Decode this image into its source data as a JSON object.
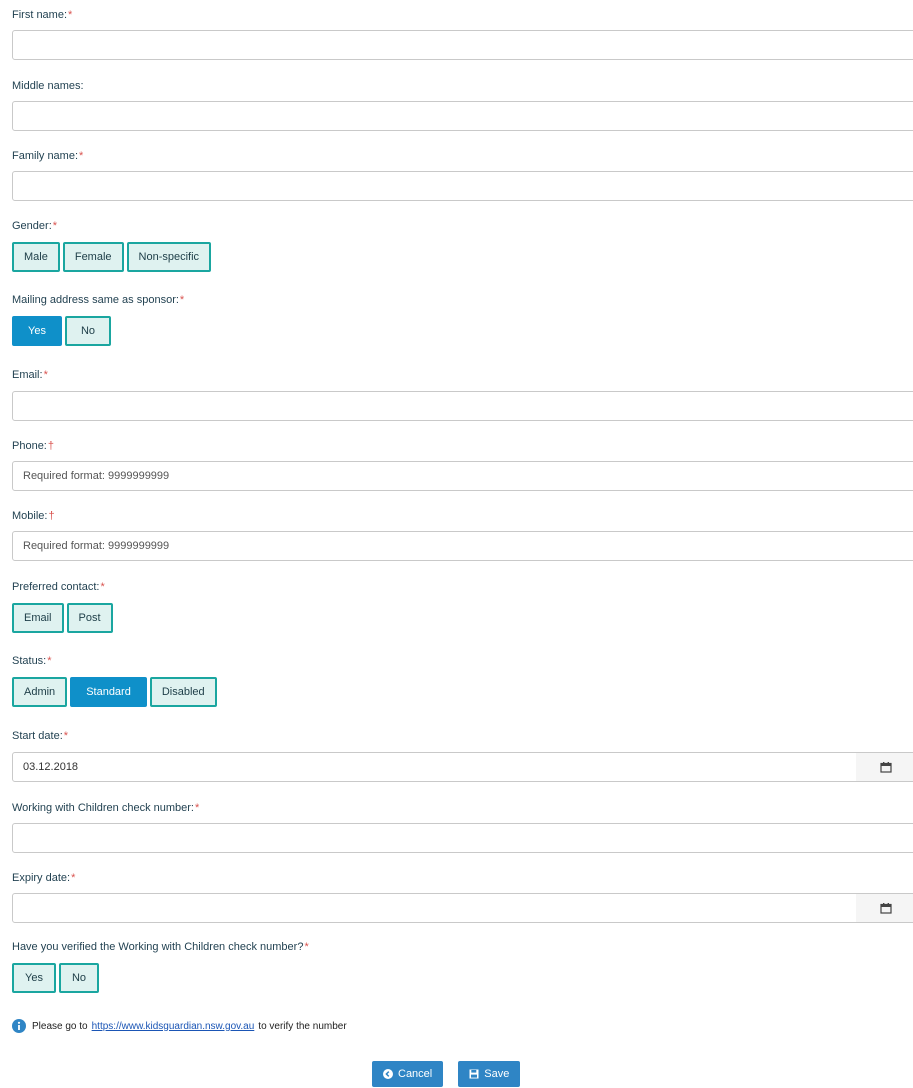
{
  "form": {
    "first_name": {
      "label": "First name:",
      "required": "*",
      "value": ""
    },
    "middle_names": {
      "label": "Middle names:",
      "value": ""
    },
    "family_name": {
      "label": "Family name:",
      "required": "*",
      "value": ""
    },
    "gender": {
      "label": "Gender:",
      "required": "*",
      "options": [
        "Male",
        "Female",
        "Non-specific"
      ]
    },
    "mailing_same": {
      "label": "Mailing address same as sponsor:",
      "required": "*",
      "options": [
        "Yes",
        "No"
      ],
      "selected": "Yes"
    },
    "email": {
      "label": "Email:",
      "required": "*",
      "value": ""
    },
    "phone": {
      "label": "Phone:",
      "marker": "†",
      "placeholder": "Required format: 9999999999"
    },
    "mobile": {
      "label": "Mobile:",
      "marker": "†",
      "placeholder": "Required format: 9999999999"
    },
    "preferred_contact": {
      "label": "Preferred contact:",
      "required": "*",
      "options": [
        "Email",
        "Post"
      ]
    },
    "status": {
      "label": "Status:",
      "required": "*",
      "options": [
        "Admin",
        "Standard",
        "Disabled"
      ],
      "selected": "Standard"
    },
    "start_date": {
      "label": "Start date:",
      "required": "*",
      "value": "03.12.2018",
      "icon": "calendar-icon"
    },
    "wwc_number": {
      "label": "Working with Children check number:",
      "required": "*",
      "value": ""
    },
    "expiry_date": {
      "label": "Expiry date:",
      "required": "*",
      "value": "",
      "icon": "calendar-icon"
    },
    "wwc_verified": {
      "label": "Have you verified the Working with Children check number?",
      "required": "*",
      "options": [
        "Yes",
        "No"
      ]
    }
  },
  "info": {
    "icon": "info-icon",
    "prefix": "Please go to",
    "link": "https://www.kidsguardian.nsw.gov.au",
    "suffix": "to verify the number"
  },
  "actions": {
    "cancel_label": "Cancel",
    "cancel_icon": "cancel-icon",
    "save_label": "Save",
    "save_icon": "save-icon"
  },
  "colors": {
    "toggle_border": "#1aa6a0",
    "toggle_bg": "#dff2f0",
    "toggle_active": "#0f90c9",
    "action_button": "#2f85c5",
    "required": "#d9534f"
  }
}
